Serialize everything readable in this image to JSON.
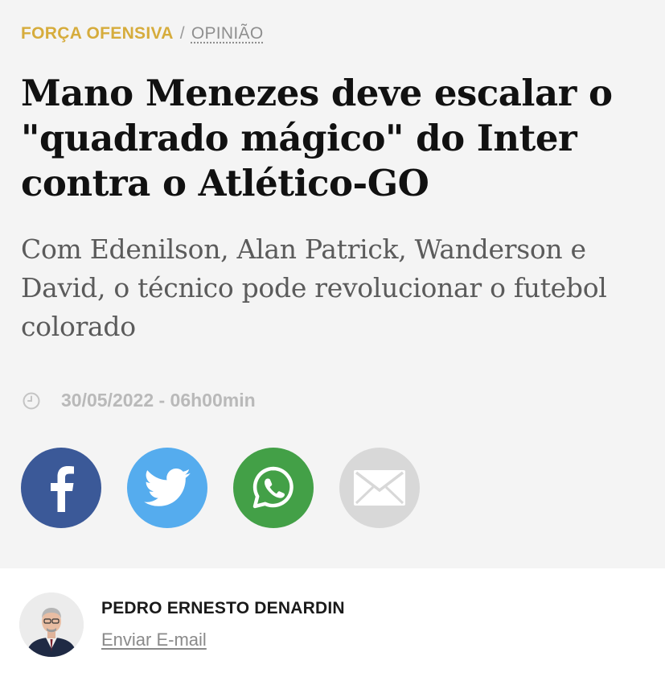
{
  "breadcrumb": {
    "section": "FORÇA OFENSIVA",
    "separator": "/",
    "subsection": "OPINIÃO"
  },
  "article": {
    "headline": "Mano Menezes deve escalar o \"quadrado mágico\" do Inter contra o Atlético-GO",
    "subtitle": "Com Edenilson, Alan Patrick, Wanderson e David, o técnico pode revolucionar o futebol colorado",
    "timestamp": "30/05/2022 - 06h00min"
  },
  "share": {
    "buttons": [
      {
        "icon": "facebook-icon",
        "color": "#3b5998"
      },
      {
        "icon": "twitter-icon",
        "color": "#55acee"
      },
      {
        "icon": "whatsapp-icon",
        "color": "#43a047"
      },
      {
        "icon": "email-icon",
        "color": "#d8d8d8"
      }
    ]
  },
  "author": {
    "name": "PEDRO ERNESTO DENARDIN",
    "email_link": "Enviar E-mail"
  },
  "colors": {
    "section_accent": "#d6ac3c",
    "header_background": "#f4f4f4",
    "headline_text": "#111111",
    "subtitle_text": "#5b5b5b",
    "meta_text": "#b9b9b9"
  }
}
